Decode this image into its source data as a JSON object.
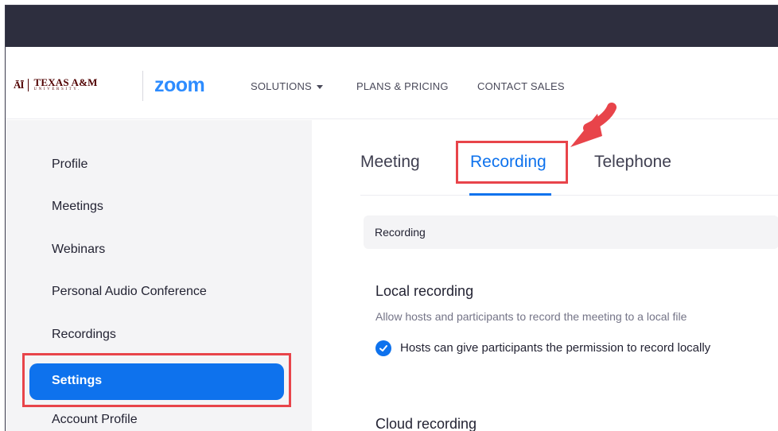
{
  "brand": {
    "tamu_mark": "ĀĪ",
    "tamu_name": "TEXAS A&M",
    "tamu_sub": "UNIVERSITY.",
    "zoom_logo": "zoom"
  },
  "nav": {
    "solutions": "SOLUTIONS",
    "plans": "PLANS & PRICING",
    "contact": "CONTACT SALES"
  },
  "sidebar": {
    "items": [
      {
        "label": "Profile"
      },
      {
        "label": "Meetings"
      },
      {
        "label": "Webinars"
      },
      {
        "label": "Personal Audio Conference"
      },
      {
        "label": "Recordings"
      },
      {
        "label": "Settings"
      },
      {
        "label": "Account Profile"
      }
    ]
  },
  "tabs": {
    "meeting": "Meeting",
    "recording": "Recording",
    "telephone": "Telephone"
  },
  "section": {
    "label": "Recording"
  },
  "settings": {
    "local_title": "Local recording",
    "local_desc": "Allow hosts and participants to record the meeting to a local file",
    "local_check_label": "Hosts can give participants the permission to record locally",
    "local_check_checked": true,
    "cloud_title": "Cloud recording"
  },
  "colors": {
    "accent": "#0e72ed",
    "highlight": "#e8444a",
    "topbar": "#2d2e3e",
    "tamu_maroon": "#500000"
  }
}
